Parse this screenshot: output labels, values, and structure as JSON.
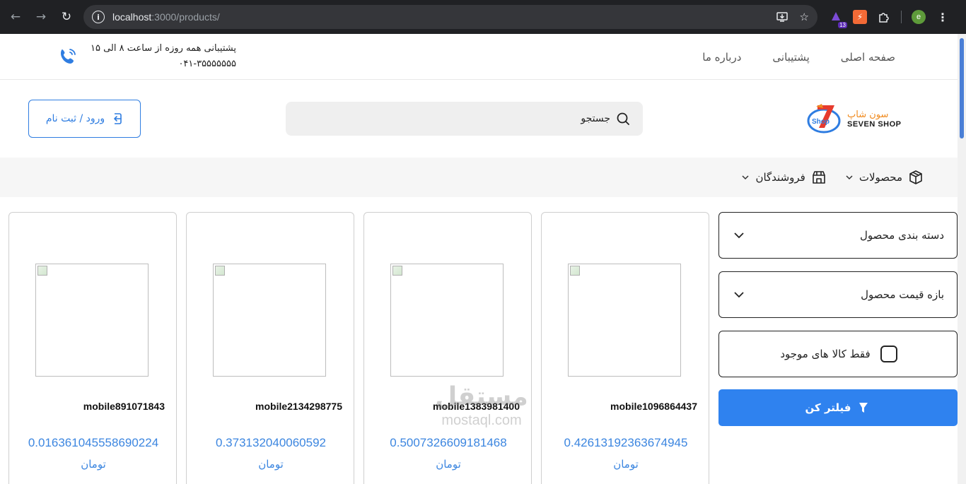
{
  "browser": {
    "url_host": "localhost",
    "url_rest": ":3000/products/",
    "extension_badge": "13",
    "profile_initial": "e"
  },
  "topbar": {
    "nav": [
      "صفحه اصلی",
      "پشتیبانی",
      "درباره ما"
    ],
    "support_line1": "پشتیبانی همه روزه از ساعت ۸ الی ۱۵",
    "support_phone": "۰۴۱-۳۵۵۵۵۵۵۵"
  },
  "header": {
    "logo_fa": "سون شاپ",
    "logo_en": "SEVEN SHOP",
    "logo_mark": "Shop",
    "search_placeholder": "جستجو",
    "login_label": "ورود / ثبت نام"
  },
  "categories": {
    "products": "محصولات",
    "sellers": "فروشندگان"
  },
  "filters": {
    "category": "دسته بندی محصول",
    "price_range": "بازه قیمت محصول",
    "in_stock": "فقط کالا های موجود",
    "apply": "فیلتر کن"
  },
  "products": [
    {
      "title": "mobile1096864437",
      "price": "0.42613192363674945",
      "currency": "تومان"
    },
    {
      "title": "mobile1383981400",
      "price": "0.5007326609181468",
      "currency": "تومان"
    },
    {
      "title": "mobile2134298775",
      "price": "0.373132040060592",
      "currency": "تومان"
    },
    {
      "title": "mobile891071843",
      "price": "0.016361045558690224",
      "currency": "تومان"
    }
  ],
  "watermark": {
    "arabic": "مستقل",
    "latin": "mostaql.com"
  },
  "colors": {
    "accent": "#2f82ef",
    "price": "#3c86e0",
    "logo_orange": "#f08a1e"
  }
}
